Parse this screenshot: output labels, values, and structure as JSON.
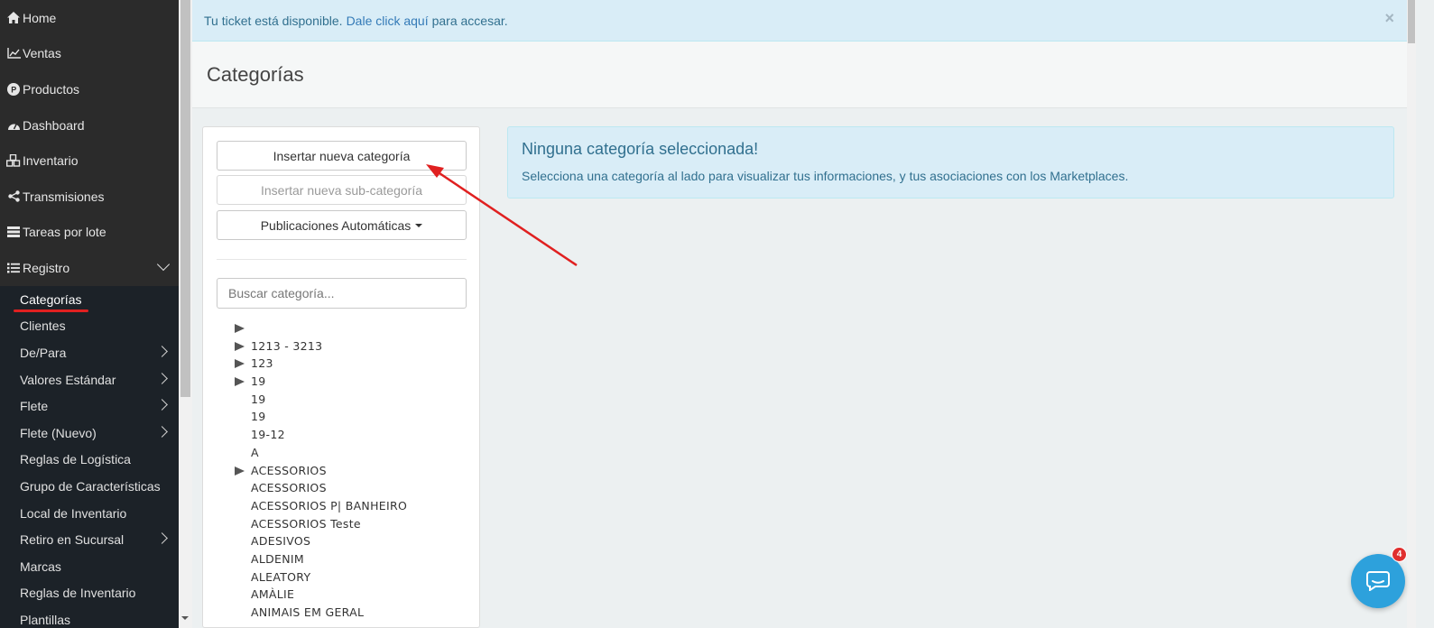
{
  "sidebar": {
    "items": [
      {
        "icon": "home-icon",
        "label": "Home"
      },
      {
        "icon": "line-chart-icon",
        "label": "Ventas"
      },
      {
        "icon": "product-p-icon",
        "label": "Productos"
      },
      {
        "icon": "dashboard-icon",
        "label": "Dashboard"
      },
      {
        "icon": "cubes-icon",
        "label": "Inventario"
      },
      {
        "icon": "share-icon",
        "label": "Transmisiones"
      },
      {
        "icon": "server-icon",
        "label": "Tareas por lote"
      },
      {
        "icon": "list-icon",
        "label": "Registro"
      }
    ],
    "submenu": [
      {
        "label": "Categorías"
      },
      {
        "label": "Clientes"
      },
      {
        "label": "De/Para"
      },
      {
        "label": "Valores Estándar"
      },
      {
        "label": "Flete"
      },
      {
        "label": "Flete (Nuevo)"
      },
      {
        "label": "Reglas de Logística"
      },
      {
        "label": "Grupo de Características"
      },
      {
        "label": "Local de Inventario"
      },
      {
        "label": "Retiro en Sucursal"
      },
      {
        "label": "Marcas"
      },
      {
        "label": "Reglas de Inventario"
      },
      {
        "label": "Plantillas"
      }
    ]
  },
  "alert": {
    "text_before": "Tu ticket está disponible.",
    "link": "Dale click aquí",
    "text_after": "para accesar.",
    "close": "×"
  },
  "page": {
    "title": "Categorías"
  },
  "actions": {
    "insert_category": "Insertar nueva categoría",
    "insert_subcategory": "Insertar nueva sub-categoría",
    "auto_publish": "Publicaciones Automáticas"
  },
  "search": {
    "placeholder": "Buscar categoría..."
  },
  "tree": [
    {
      "label": "",
      "expandable": true
    },
    {
      "label": "1213 - 3213",
      "expandable": true
    },
    {
      "label": "123",
      "expandable": true
    },
    {
      "label": "19",
      "expandable": true
    },
    {
      "label": "19",
      "expandable": false
    },
    {
      "label": "19",
      "expandable": false
    },
    {
      "label": "19-12",
      "expandable": false
    },
    {
      "label": "A",
      "expandable": false
    },
    {
      "label": "ACESSORIOS",
      "expandable": true
    },
    {
      "label": "ACESSORIOS",
      "expandable": false
    },
    {
      "label": "ACESSORIOS P| BANHEIRO",
      "expandable": false
    },
    {
      "label": "ACESSORIOS Teste",
      "expandable": false
    },
    {
      "label": "ADESIVOS",
      "expandable": false
    },
    {
      "label": "ALDENIM",
      "expandable": false
    },
    {
      "label": "ALEATORY",
      "expandable": false
    },
    {
      "label": "AMÀLIE",
      "expandable": false
    },
    {
      "label": "ANIMAIS EM GERAL",
      "expandable": false
    }
  ],
  "info": {
    "title": "Ninguna categoría seleccionada!",
    "text": "Selecciona una categoría al lado para visualizar tus informaciones, y tus asociaciones con los Marketplaces."
  },
  "chat": {
    "badge": "4"
  },
  "colors": {
    "sidebar_bg": "#2b2b2b",
    "submenu_bg": "#1c2228",
    "info_bg": "#d9edf7",
    "info_text": "#31708f",
    "chat_blue": "#2da1dc",
    "annotation_red": "#e02020"
  }
}
